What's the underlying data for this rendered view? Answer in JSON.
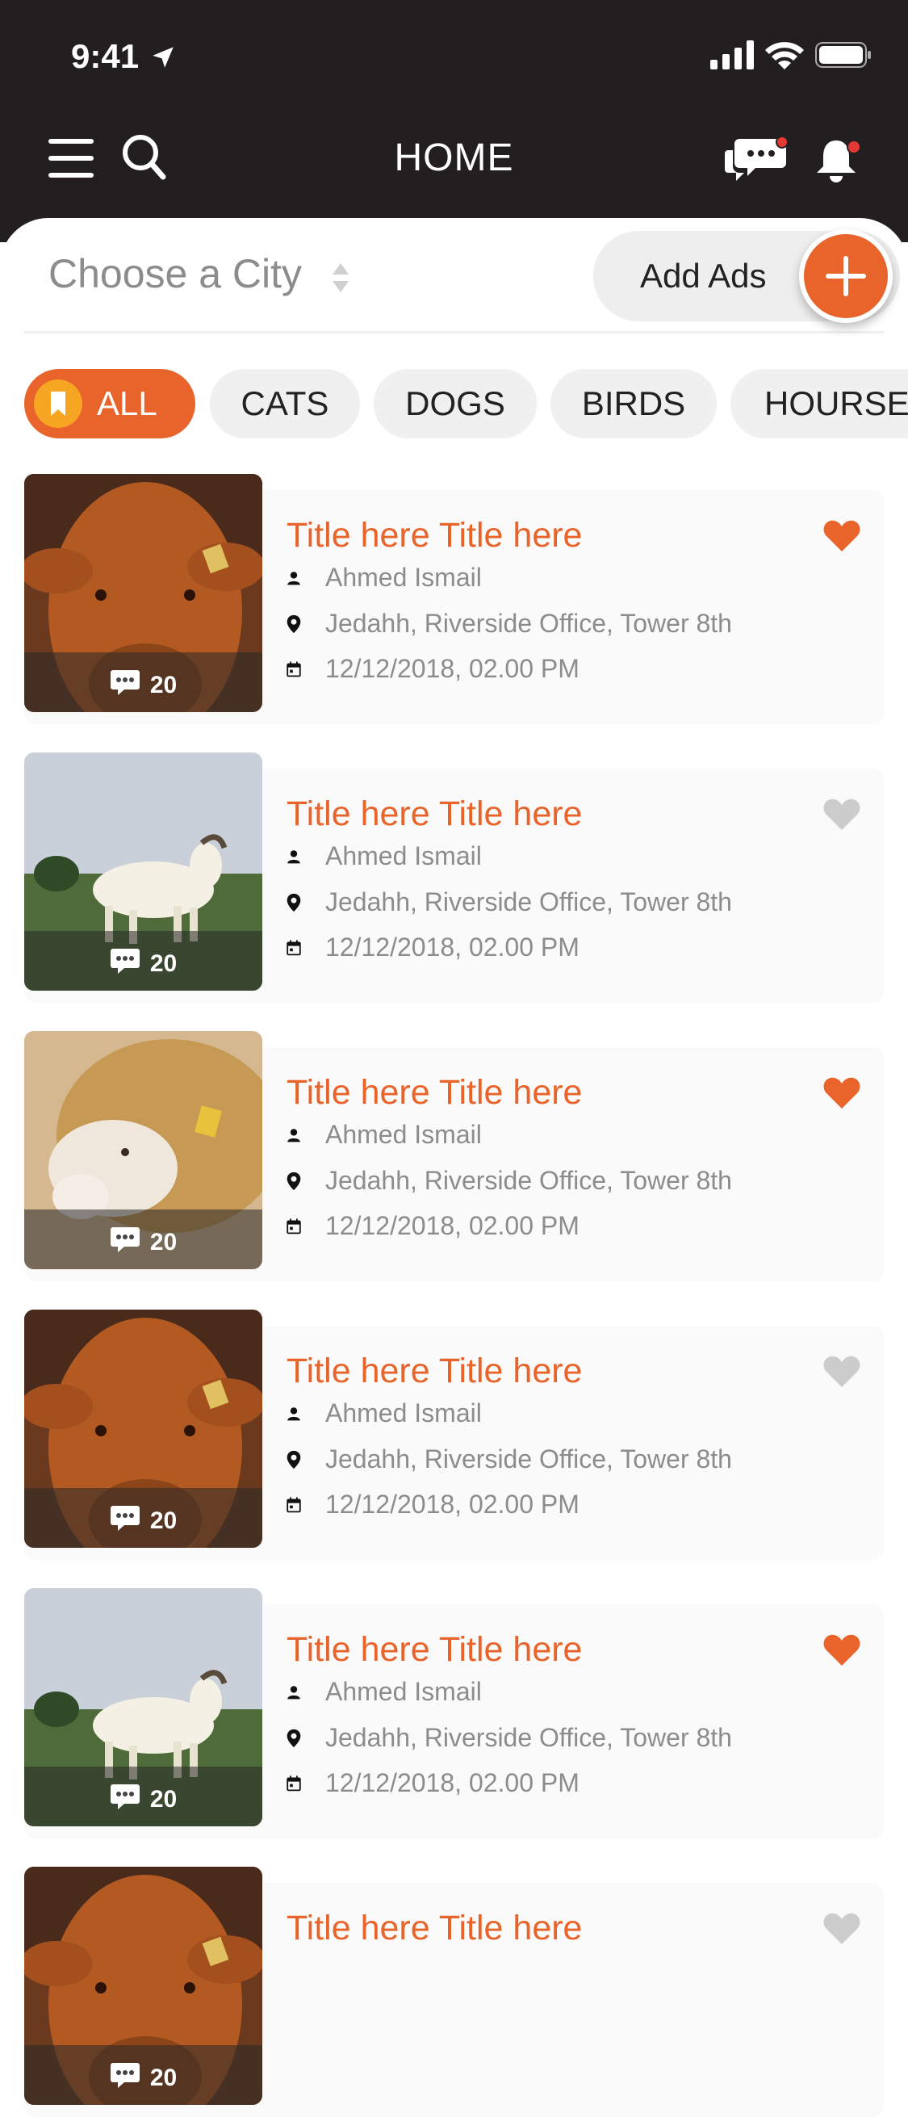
{
  "status_bar": {
    "time": "9:41"
  },
  "nav": {
    "title": "HOME"
  },
  "city_selector": {
    "placeholder": "Choose a City"
  },
  "add_ads": {
    "label": "Add Ads"
  },
  "categories": [
    {
      "label": "ALL",
      "active": true
    },
    {
      "label": "CATS",
      "active": false
    },
    {
      "label": "DOGS",
      "active": false
    },
    {
      "label": "BIRDS",
      "active": false
    },
    {
      "label": "HOURSES",
      "active": false
    }
  ],
  "listings": [
    {
      "title": "Title here Title here",
      "author": "Ahmed Ismail",
      "location": "Jedahh, Riverside Office, Tower 8th",
      "date": "12/12/2018, 02.00 PM",
      "comments": "20",
      "favorited": true,
      "image": "cow"
    },
    {
      "title": "Title here Title here",
      "author": "Ahmed Ismail",
      "location": "Jedahh, Riverside Office, Tower 8th",
      "date": "12/12/2018, 02.00 PM",
      "comments": "20",
      "favorited": false,
      "image": "goat"
    },
    {
      "title": "Title here Title here",
      "author": "Ahmed Ismail",
      "location": "Jedahh, Riverside Office, Tower 8th",
      "date": "12/12/2018, 02.00 PM",
      "comments": "20",
      "favorited": true,
      "image": "sheep"
    },
    {
      "title": "Title here Title here",
      "author": "Ahmed Ismail",
      "location": "Jedahh, Riverside Office, Tower 8th",
      "date": "12/12/2018, 02.00 PM",
      "comments": "20",
      "favorited": false,
      "image": "cow"
    },
    {
      "title": "Title here Title here",
      "author": "Ahmed Ismail",
      "location": "Jedahh, Riverside Office, Tower 8th",
      "date": "12/12/2018, 02.00 PM",
      "comments": "20",
      "favorited": true,
      "image": "goat"
    },
    {
      "title": "Title here Title here",
      "comments": "20",
      "favorited": false,
      "image": "cow"
    }
  ],
  "colors": {
    "accent": "#e8642a",
    "header": "#231f20",
    "notification_dot": "#e53935",
    "favorite_off": "#cccccc"
  }
}
